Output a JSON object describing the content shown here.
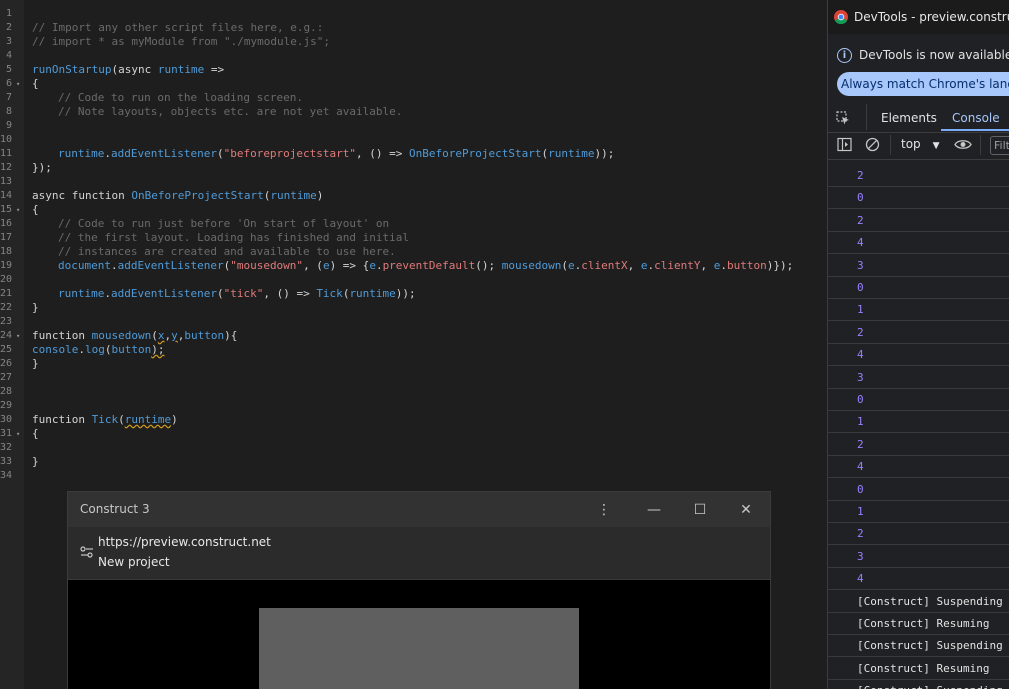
{
  "editor": {
    "line_numbers": [
      "1",
      "2",
      "3",
      "4",
      "5",
      "6",
      "7",
      "8",
      "9",
      "10",
      "11",
      "12",
      "13",
      "14",
      "15",
      "16",
      "17",
      "18",
      "19",
      "20",
      "21",
      "22",
      "23",
      "24",
      "25",
      "26",
      "27",
      "28",
      "29",
      "30",
      "31",
      "32",
      "33",
      "34"
    ],
    "fold_marker": "▾",
    "code": {
      "l2": "// Import any other script files here, e.g.:",
      "l3": "// import * as myModule from \"./mymodule.js\";",
      "l5_fn": "runOnStartup",
      "l5_a": "(async ",
      "l5_id": "runtime",
      "l5_b": " =>",
      "l6": "{",
      "l7": "// Code to run on the loading screen.",
      "l8": "// Note layouts, objects etc. are not yet available.",
      "l11_id": "runtime",
      "l11_a": ".",
      "l11_fn": "addEventListener",
      "l11_b": "(",
      "l11_str": "\"beforeprojectstart\"",
      "l11_c": ", () => ",
      "l11_fn2": "OnBeforeProjectStart",
      "l11_d": "(",
      "l11_id2": "runtime",
      "l11_e": "));",
      "l12": "});",
      "l14_a": "async function ",
      "l14_fn": "OnBeforeProjectStart",
      "l14_b": "(",
      "l14_id": "runtime",
      "l14_c": ")",
      "l15": "{",
      "l16": "// Code to run just before 'On start of layout' on",
      "l17": "// the first layout. Loading has finished and initial",
      "l18": "// instances are created and available to use here.",
      "l19_id": "document",
      "l19_a": ".",
      "l19_fn": "addEventListener",
      "l19_b": "(",
      "l19_str": "\"mousedown\"",
      "l19_c": ", (",
      "l19_id2": "e",
      "l19_d": ") => {",
      "l19_id3": "e",
      "l19_e": ".",
      "l19_fn2": "preventDefault",
      "l19_f": "(); ",
      "l19_fn3": "mousedown",
      "l19_g": "(",
      "l19_id4": "e",
      "l19_h": ".",
      "l19_str2": "clientX",
      "l19_i": ", ",
      "l19_id5": "e",
      "l19_j": ".",
      "l19_str3": "clientY",
      "l19_k": ", ",
      "l19_id6": "e",
      "l19_l": ".",
      "l19_str4": "button",
      "l19_m": ")});",
      "l21_id": "runtime",
      "l21_a": ".",
      "l21_fn": "addEventListener",
      "l21_b": "(",
      "l21_str": "\"tick\"",
      "l21_c": ", () => ",
      "l21_fn2": "Tick",
      "l21_d": "(",
      "l21_id2": "runtime",
      "l21_e": "));",
      "l22": "}",
      "l24_a": "function ",
      "l24_fn": "mousedown",
      "l24_b": "(",
      "l24_x": "x",
      "l24_c": ",",
      "l24_y": "y",
      "l24_d": ",",
      "l24_btn": "button",
      "l24_e": "){",
      "l25_id": "console",
      "l25_a": ".",
      "l25_fn": "log",
      "l25_b": "(",
      "l25_id2": "button",
      "l25_c": ");",
      "l26": "}",
      "l30_a": "function ",
      "l30_fn": "Tick",
      "l30_b": "(",
      "l30_id": "runtime",
      "l30_c": ")",
      "l31": "{",
      "l33": "}"
    }
  },
  "popup": {
    "title": "Construct 3",
    "url": "https://preview.construct.net",
    "page_title": "New project",
    "menu_icon": "⋮",
    "minimize_icon": "—",
    "maximize_icon": "☐",
    "close_icon": "✕"
  },
  "devtools": {
    "title": "DevTools - preview.construct.n",
    "info_text": "DevTools is now available in",
    "lang_button": "Always match Chrome's langua",
    "tabs": {
      "elements": "Elements",
      "console": "Console"
    },
    "context": "top",
    "filter_placeholder": "Filt",
    "logs": [
      "2",
      "0",
      "2",
      "4",
      "3",
      "0",
      "1",
      "2",
      "4",
      "3",
      "0",
      "1",
      "2",
      "4",
      "0",
      "1",
      "2",
      "3",
      "4",
      "[Construct] Suspending",
      "[Construct] Resuming",
      "[Construct] Suspending",
      "[Construct] Resuming",
      "[Construct] Suspending"
    ],
    "colors": {
      "number": "#9980ff",
      "accent": "#7cacf8"
    }
  }
}
